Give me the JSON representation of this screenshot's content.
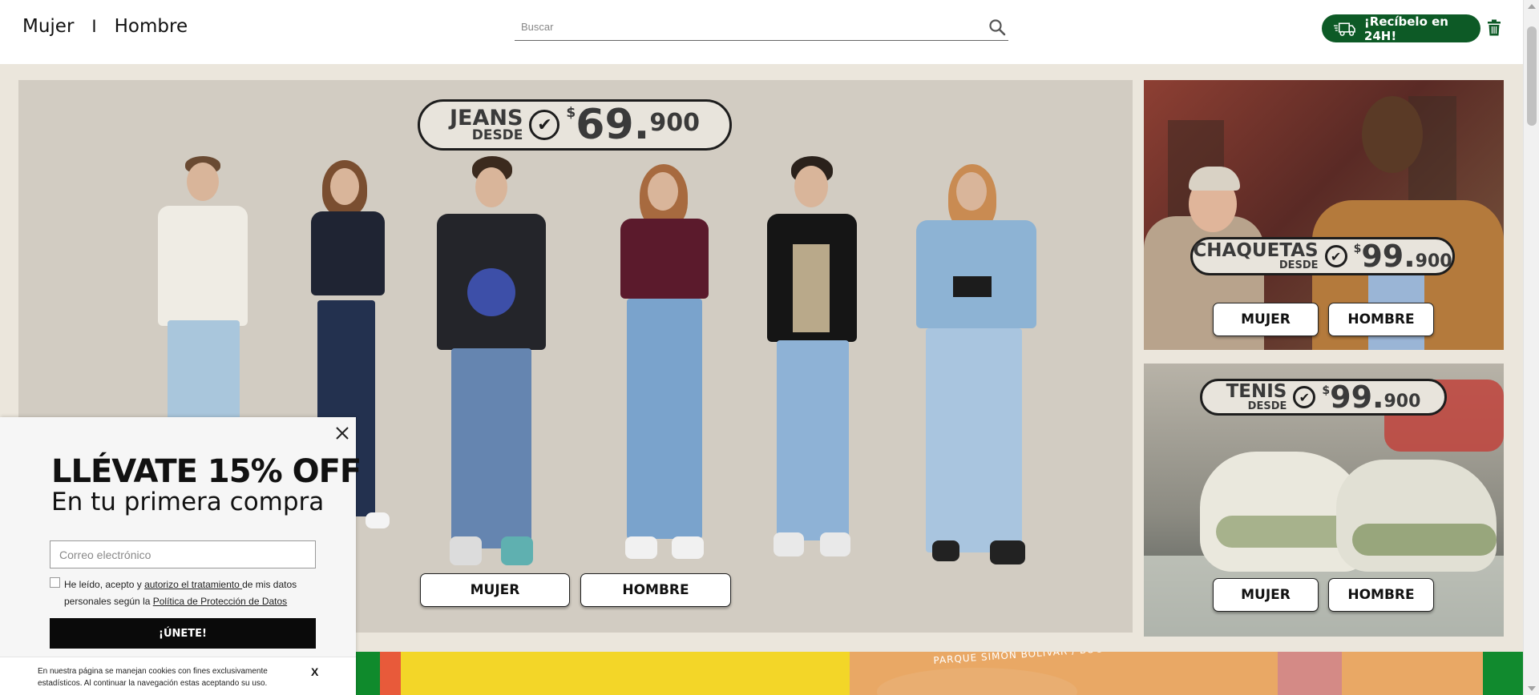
{
  "header": {
    "nav_women": "Mujer",
    "nav_sep": "I",
    "nav_men": "Hombre",
    "search_placeholder": "Buscar",
    "delivery_label": "¡Recíbelo en 24H!",
    "accent_color": "#0d5a26"
  },
  "main_banner": {
    "promo": {
      "word": "JEANS",
      "desde": "DESDE",
      "currency": "$",
      "amount": "69.",
      "cents": "900"
    },
    "button_women": "MUJER",
    "button_men": "HOMBRE"
  },
  "side_banners": [
    {
      "promo": {
        "word": "CHAQUETAS",
        "desde": "DESDE",
        "currency": "$",
        "amount": "99.",
        "cents": "900"
      },
      "button_women": "MUJER",
      "button_men": "HOMBRE"
    },
    {
      "promo": {
        "word": "TENIS",
        "desde": "DESDE",
        "currency": "$",
        "amount": "99.",
        "cents": "900"
      },
      "button_women": "MUJER",
      "button_men": "HOMBRE"
    }
  ],
  "bottom_strip": {
    "text": "PARQUE SIMÓN BOLÍVAR / BOGOTÁ"
  },
  "popup": {
    "title": "LLÉVATE 15% OFF",
    "subtitle": "En tu primera compra",
    "email_placeholder": "Correo electrónico",
    "legal_prefix": "He leído, acepto y ",
    "legal_link1": "autorizo el tratamiento ",
    "legal_middle": "de mis datos personales según la ",
    "legal_link2": "Política de Protección de Datos",
    "join_label": "¡ÚNETE!"
  },
  "cookie_bar": {
    "text": "En nuestra página se manejan cookies con fines exclusivamente estadísticos. Al continuar la navegación estas aceptando su uso.",
    "close_label": "X"
  }
}
